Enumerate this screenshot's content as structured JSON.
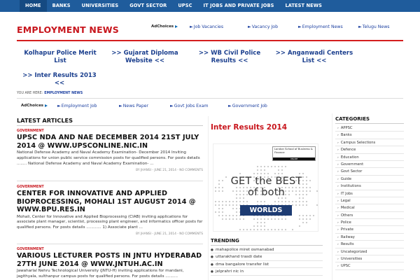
{
  "nav": {
    "items": [
      "HOME",
      "BANKS",
      "UNIVERSITIES",
      "GOVT SECTOR",
      "UPSC",
      "IT JOBS AND PRIVATE JOBS",
      "LATEST NEWS"
    ]
  },
  "header": {
    "site_title": "EMPLOYMENT NEWS",
    "adchoices_label": "AdChoices",
    "ad_links": [
      "Job Vacancies",
      "Vacancy Job",
      "Employment News",
      "Telugu News"
    ]
  },
  "link_unit": {
    "links": [
      "Kolhapur Police Merit List",
      ">> Gujarat Diploma Website <<",
      ">> WB Civil Police Results <<",
      ">> Anganwadi Centers List <<",
      ">> Inter Results 2013 <<"
    ]
  },
  "breadcrumb": {
    "prefix": "YOU ARE HERE:",
    "current": "EMPLOYMENT NEWS"
  },
  "ad_row2": {
    "adchoices_label": "AdChoices",
    "links": [
      "Employment Job",
      "News Paper",
      "Govt Jobs Exam",
      "Government Job"
    ]
  },
  "latest": {
    "heading": "LATEST ARTICLES",
    "articles": [
      {
        "category": "GOVERNMENT",
        "title": "UPSC NDA AND NAE DECEMBER 2014 21ST JULY 2014 @ WWW.UPSCONLINE.NIC.IN",
        "excerpt": "National Defense Academy and Naval Academy Examination- December 2014 Inviting applications for union public service commission posts for qualified persons.   For posts details ........ National Defense Academy and Naval Academy Examination- ...",
        "meta": "BY JHANSI - JUNE 21, 2014 - NO COMMENTS"
      },
      {
        "category": "GOVERNMENT",
        "title": "CENTER FOR INNOVATIVE AND APPLIED BIOPROCESSING, MOHALI 1ST AUGUST 2014 @ WWW.BPU.RES.IN",
        "excerpt": "Mohali, Center for Innovative and Applied Bioprocessing (CIAB) inviting applications for associate plant manager, scientist, processing plant engineer, and informatics officer posts for qualified persons. For posts details ............ 1)        Associate plant ...",
        "meta": "BY JHANSI - JUNE 21, 2014 - NO COMMENTS"
      },
      {
        "category": "GOVERNMENT",
        "title": "VARIOUS LECTURER POSTS IN JNTU HYDERABAD 27TH JUNE 2014 @ WWW.JNTUH.AC.IN",
        "excerpt": "Jawaharlal Nehru Technological University (JNTU-H) inviting applications for mandani, jagithyala, sulthanpur campus posts for qualified persons. For posts details ..........",
        "meta": ""
      }
    ]
  },
  "middle": {
    "title": "Inter Results 2014",
    "ad": {
      "lbs_text": "London School of Business & Finance",
      "lbs_online": "ONLINE",
      "headline_line1": "GET the BEST",
      "headline_line2": "of both",
      "worlds": "WORLDS"
    },
    "trending_heading": "TRENDING",
    "trending": [
      "mahapolice miret osmanabad",
      "uttarakhand trasdi date",
      "dma bangalore transfer list",
      "jelprahri nic in"
    ]
  },
  "categories": {
    "heading": "CATEGORIES",
    "items": [
      "APPSC",
      "Banks",
      "Campus Selections",
      "Defence",
      "Education",
      "Government",
      "Govt Sector",
      "Guide",
      "Institutions",
      "IT Jobs",
      "Legal",
      "Medical",
      "Others",
      "Police",
      "Private",
      "Railway",
      "Results",
      "Uncategorized",
      "Universities",
      "UPSC"
    ]
  },
  "colors": {
    "nav_bg": "#1f5c9c",
    "title_red": "#c8161d",
    "link_blue": "#1b3fa0"
  }
}
